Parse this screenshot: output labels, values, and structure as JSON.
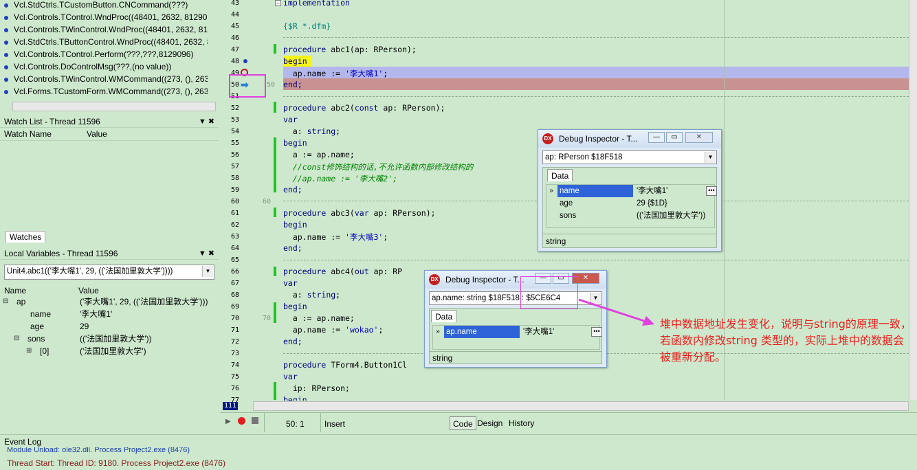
{
  "call_stack": {
    "items": [
      "Vcl.StdCtrls.TCustomButton.CNCommand(???)",
      "Vcl.Controls.TControl.WndProc((48401, 2632, 812909",
      "Vcl.Controls.TWinControl.WndProc((48401, 2632, 812",
      "Vcl.StdCtrls.TButtonControl.WndProc((48401, 2632, 8",
      "Vcl.Controls.TControl.Perform(???,???,8129096)",
      "Vcl.Controls.DoControlMsg(???,(no value))",
      "Vcl.Controls.TWinControl.WMCommand((273, (), 263",
      "Vcl.Forms.TCustomForm.WMCommand((273, (), 263"
    ]
  },
  "watch_list": {
    "title": "Watch List - Thread 11596",
    "col_name": "Watch Name",
    "col_value": "Value",
    "tab": "Watches"
  },
  "local_vars": {
    "title": "Local Variables - Thread 11596",
    "combo": "Unit4.abc1(('李大嘴1', 29, (('法国加里敦大学'))))",
    "col_name": "Name",
    "col_value": "Value",
    "rows": [
      {
        "expander": "⊟",
        "name": "ap",
        "value": "('李大嘴1', 29, (('法国加里敦大学')))"
      },
      {
        "expander": "",
        "name": "name",
        "value": "'李大嘴1'"
      },
      {
        "expander": "",
        "name": "age",
        "value": "29"
      },
      {
        "expander": "⊟",
        "name": "sons",
        "value": "(('法国加里敦大学'))"
      },
      {
        "expander": "⊞",
        "name": "[0]",
        "value": "('法国加里敦大学')"
      }
    ]
  },
  "editor": {
    "line_numbers": [
      "43",
      "44",
      "45",
      "46",
      "47",
      "48",
      "49",
      "50",
      "51",
      "52",
      "53",
      "54",
      "55",
      "56",
      "57",
      "58",
      "59",
      "60",
      "61",
      "62",
      "63",
      "64",
      "65",
      "66",
      "67",
      "68",
      "69",
      "70",
      "71",
      "72",
      "73",
      "74",
      "75",
      "76",
      "77"
    ],
    "gutter_marks": {
      "l50": "50",
      "l60": "60",
      "l70": "70"
    },
    "current_line": "111",
    "code": {
      "l43": "implementation",
      "l45": "{$R *.dfm}",
      "l47a": "procedure",
      "l47b": " abc1(ap: RPerson);",
      "l48": "begin",
      "l49": "  ap.name := ",
      "l49s": "'李大嘴1'",
      "l49e": ";",
      "l50": "end;",
      "l52a": "procedure",
      "l52b": " abc2(",
      "l52c": "const",
      "l52d": " ap: RPerson);",
      "l53": "var",
      "l54a": "  a: ",
      "l54b": "string",
      "l54c": ";",
      "l55": "begin",
      "l56": "  a := ap.name;",
      "l57": "  //const修饰结构的话,不允许函数内部修改结构的",
      "l58": "  //ap.name := '李大嘴2';",
      "l59": "end;",
      "l61a": "procedure",
      "l61b": " abc3(",
      "l61c": "var",
      "l61d": " ap: RPerson);",
      "l62": "begin",
      "l63": "  ap.name := ",
      "l63s": "'李大嘴3'",
      "l63e": ";",
      "l64": "end;",
      "l66a": "procedure",
      "l66b": " abc4(",
      "l66c": "out",
      "l66d": " ap: RP",
      "l67": "var",
      "l68a": "  a: ",
      "l68b": "string",
      "l68c": ";",
      "l69": "begin",
      "l70": "  a := ap.name;",
      "l71": "  ap.name := ",
      "l71s": "'wokao'",
      "l71e": ";",
      "l72": "end;",
      "l74a": "procedure",
      "l74b": " TForm4.Button1Cl",
      "l75": "var",
      "l76": "  ip: RPerson;",
      "l77": "begin"
    }
  },
  "inspector1": {
    "title": "Debug Inspector - T...",
    "combo": "ap: RPerson $18F518",
    "tab": "Data",
    "rows": [
      {
        "name": "name",
        "value": "'李大嘴1'"
      },
      {
        "name": "age",
        "value": "29 {$1D}"
      },
      {
        "name": "sons",
        "value": "(('法国加里敦大学'))"
      }
    ],
    "footer": "string"
  },
  "inspector2": {
    "title": "Debug Inspector - T...",
    "combo": "ap.name: string $18F518 : $5CE6C4",
    "tab": "Data",
    "rows": [
      {
        "name": "ap.name",
        "value": "'李大嘴1'"
      }
    ],
    "footer": "string"
  },
  "status": {
    "position": "50:  1",
    "mode": "Insert",
    "tabs": [
      "Code",
      "Design",
      "History"
    ]
  },
  "event_log": {
    "title": "Event Log",
    "lines": [
      "Module Unload: ole32.dll. Process Project2.exe (8476)",
      "Thread Start: Thread ID: 9180. Process Project2.exe (8476)"
    ]
  },
  "annotation": "堆中数据地址发生变化，说明与string的原理一致，若函数内修改string 类型的，实际上堆中的数据会被重新分配。",
  "colors": {
    "annotation": "#ee1c1c",
    "highlight_box": "#e040e0",
    "selection": "#2f64d8"
  }
}
